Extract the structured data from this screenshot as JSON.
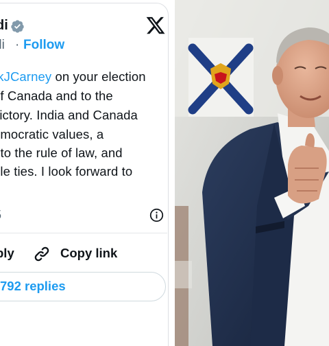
{
  "tweet": {
    "author_name_fragment": "di",
    "handle_fragment": "di",
    "handle_separator": "·",
    "follow_label": "Follow",
    "body": {
      "line1": {
        "mention": "rkJCarney",
        "rest": " on your election"
      },
      "line2": "of Canada and to the",
      "line3": "victory. India and Canada",
      "line4": "emocratic values, a",
      "line5": "t to the rule of law, and",
      "line6": "ple ties. I look forward to"
    },
    "timestamp_fragment": "5",
    "actions": {
      "reply_fragment": "ply",
      "copy_link_label": "Copy link"
    },
    "replies_button_label": "792 replies"
  },
  "icons": {
    "verified": "verified-badge-icon",
    "logo": "x-logo-icon",
    "info": "info-icon",
    "link": "link-icon"
  },
  "colors": {
    "accent": "#1d9bf0",
    "text_primary": "#0f1419",
    "text_secondary": "#536471",
    "border": "#cfd9de",
    "suit_navy": "#22324f"
  }
}
